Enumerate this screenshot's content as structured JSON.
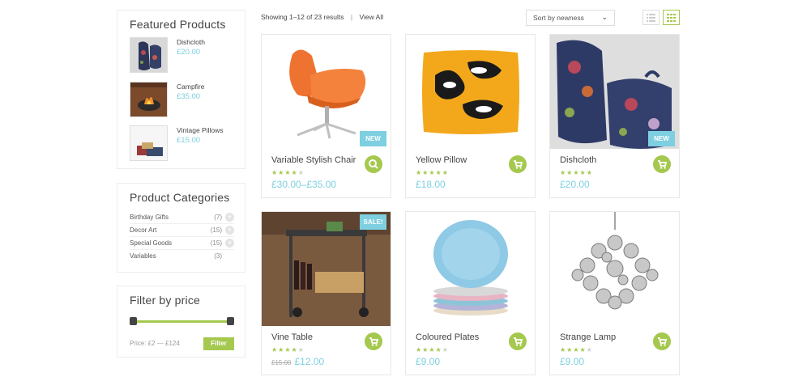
{
  "sidebar": {
    "featured": {
      "title": "Featured Products",
      "items": [
        {
          "name": "Dishcloth",
          "price": "£20.00"
        },
        {
          "name": "Campfire",
          "price": "£35.00"
        },
        {
          "name": "Vintage Pillows",
          "price": "£15.00"
        }
      ]
    },
    "categories": {
      "title": "Product Categories",
      "items": [
        {
          "name": "Birthday Gifts",
          "count": "(7)"
        },
        {
          "name": "Decor Art",
          "count": "(15)"
        },
        {
          "name": "Special Goods",
          "count": "(15)"
        },
        {
          "name": "Variables",
          "count": "(3)"
        }
      ],
      "expand_glyph": "+"
    },
    "price_filter": {
      "title": "Filter by price",
      "label": "Price: £2 — £124",
      "button": "Filter"
    }
  },
  "toolbar": {
    "result_count": "Showing 1–12 of 23 results",
    "separator": "|",
    "view_all": "View All",
    "sort_value": "Sort by newness",
    "sort_chevron": "⌄",
    "view_modes": [
      "list",
      "grid"
    ],
    "active_view": "grid"
  },
  "products": [
    {
      "name": "Variable Stylish Chair",
      "rating": 4,
      "price": "£30.00–£35.00",
      "badge": "NEW",
      "action_icon": "search-icon"
    },
    {
      "name": "Yellow Pillow",
      "rating": 5,
      "price": "£18.00",
      "action_icon": "cart-icon"
    },
    {
      "name": "Dishcloth",
      "rating": 5,
      "price": "£20.00",
      "badge": "NEW",
      "action_icon": "cart-icon"
    },
    {
      "name": "Vine Table",
      "rating": 4,
      "old_price": "£15.00",
      "price": "£12.00",
      "badge": "SALE!",
      "action_icon": "cart-icon"
    },
    {
      "name": "Coloured Plates",
      "rating": 4,
      "price": "£9.00",
      "action_icon": "cart-icon"
    },
    {
      "name": "Strange Lamp",
      "rating": 4,
      "price": "£9.00",
      "action_icon": "cart-icon"
    }
  ],
  "star_glyph": "★",
  "colors": {
    "accent_green": "#a5c84f",
    "accent_blue": "#7ecfe0",
    "text": "#444444",
    "border": "#e8e8e8"
  }
}
